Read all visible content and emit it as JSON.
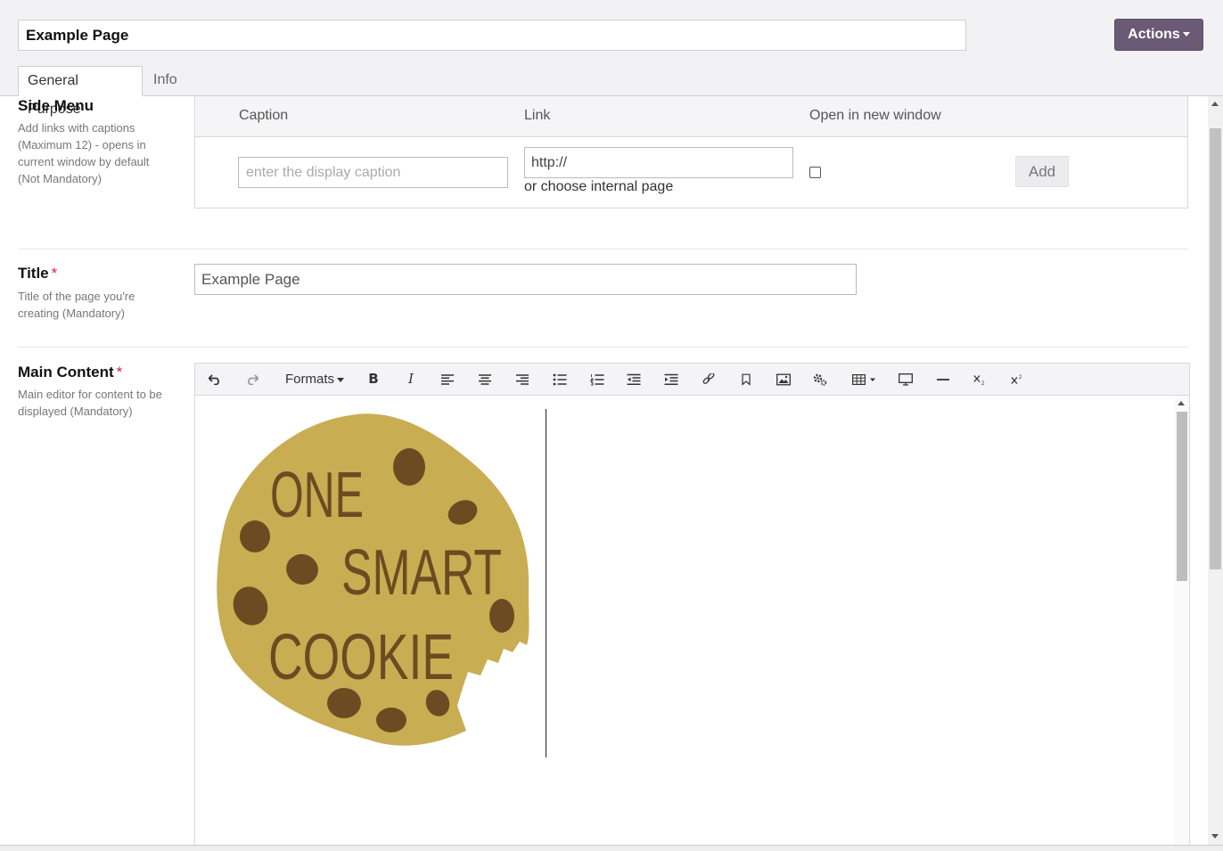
{
  "header": {
    "page_name": "Example Page",
    "actions_label": "Actions",
    "tabs": [
      {
        "label": "General Purpose",
        "active": true
      },
      {
        "label": "Info",
        "active": false
      }
    ]
  },
  "side_menu": {
    "label": "Side Menu",
    "help": "Add links with captions (Maximum 12) - opens in current window by default (Not Mandatory)",
    "columns": [
      "Caption",
      "Link",
      "Open in new window"
    ],
    "caption_placeholder": "enter the display caption",
    "link_value": "http://",
    "internal_link_text": "or choose internal page",
    "open_new_window_checked": false,
    "add_label": "Add"
  },
  "title_field": {
    "label": "Title",
    "required_mark": "*",
    "help": "Title of the page you're creating (Mandatory)",
    "value": "Example Page"
  },
  "main_content": {
    "label": "Main Content",
    "required_mark": "*",
    "help": "Main editor for content to be displayed (Mandatory)",
    "toolbar": {
      "formats_label": "Formats",
      "buttons": [
        "undo-icon",
        "redo-icon",
        "bold-icon",
        "italic-icon",
        "align-left-icon",
        "align-center-icon",
        "align-right-icon",
        "bullet-list-icon",
        "numbered-list-icon",
        "outdent-icon",
        "indent-icon",
        "link-icon",
        "bookmark-icon",
        "image-icon",
        "media-settings-icon",
        "table-icon",
        "preview-icon",
        "horizontal-rule-icon",
        "subscript-icon",
        "superscript-icon"
      ]
    },
    "image_text": {
      "line1": "ONE",
      "line2": "SMART",
      "line3": "COOKIE"
    }
  },
  "colors": {
    "accent": "#6b5a75",
    "cookie": "#c9ad52",
    "chip": "#6b4c22"
  }
}
